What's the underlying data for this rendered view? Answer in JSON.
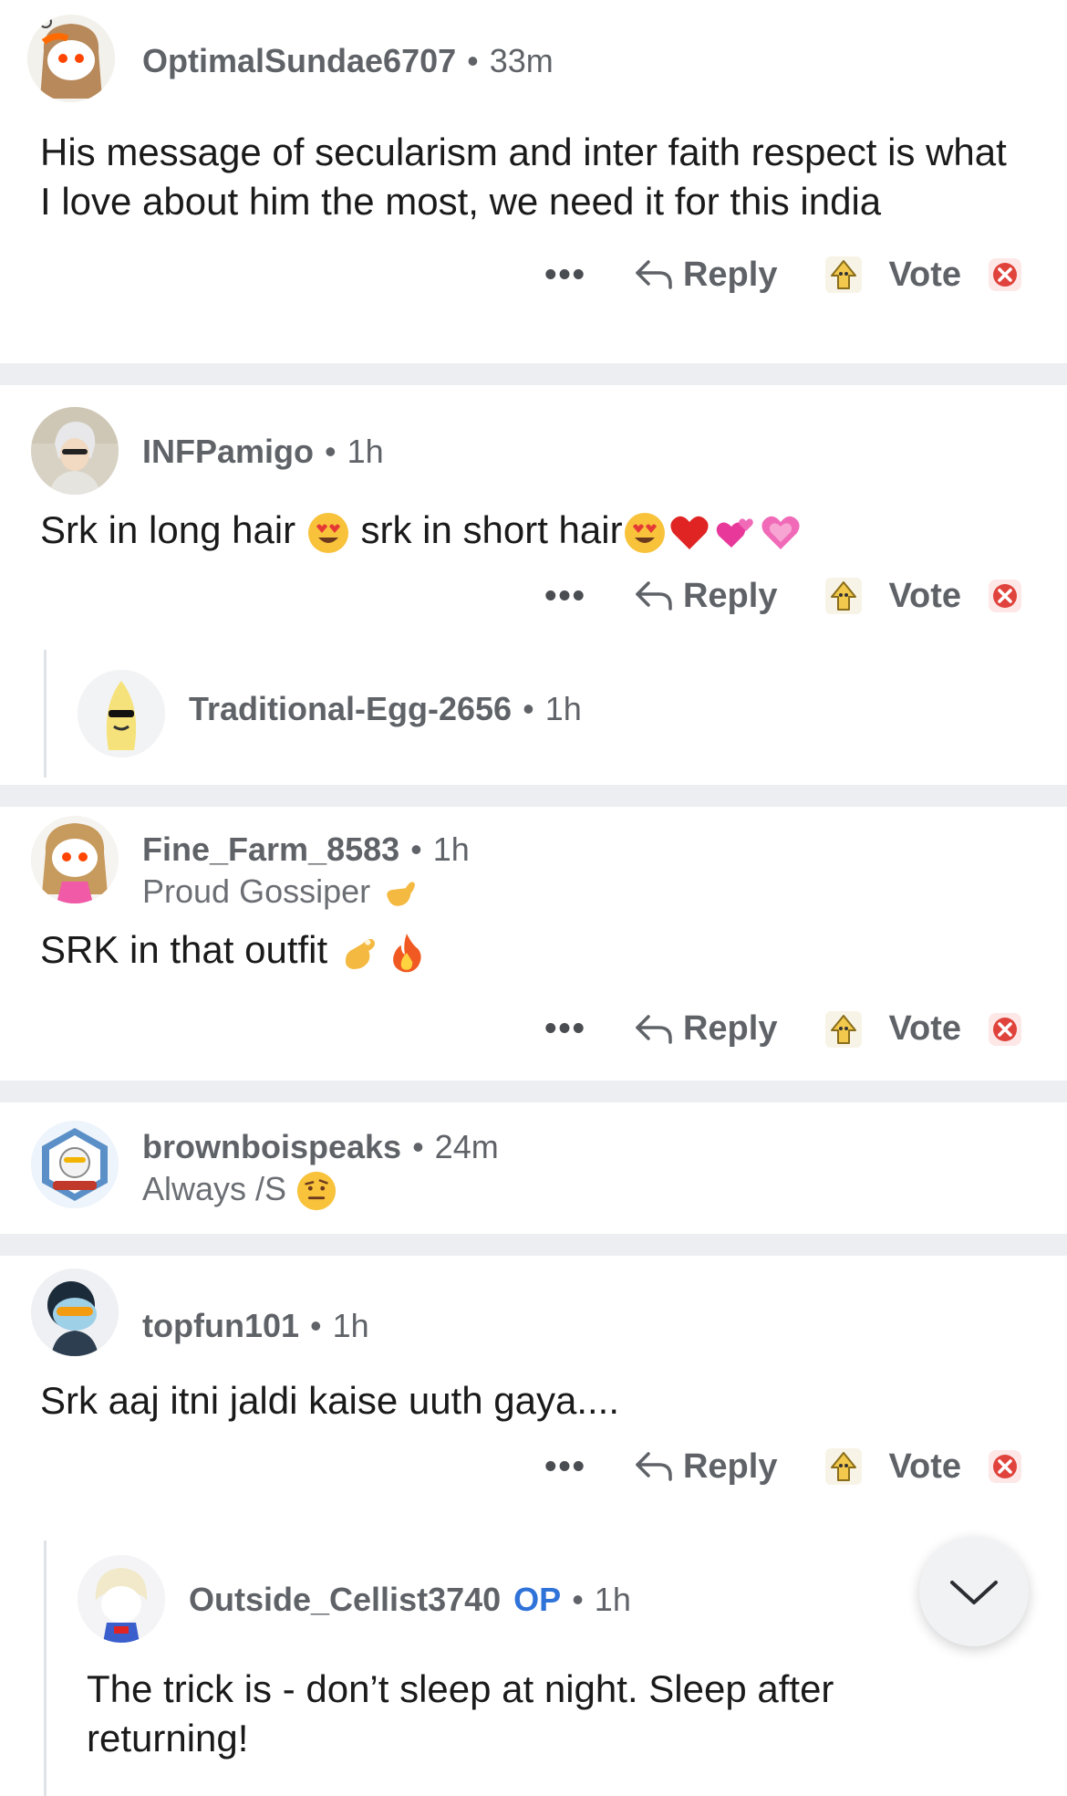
{
  "actions": {
    "more": "•••",
    "reply": "Reply",
    "vote": "Vote"
  },
  "comments": [
    {
      "user": "OptimalSundae6707",
      "time": "33m",
      "text": "His message of secularism and inter faith respect is what I love about him the most, we need it for this india"
    },
    {
      "user": "INFPamigo",
      "time": "1h",
      "text_parts": [
        "Srk in long hair ",
        " srk in short hair"
      ],
      "emojis": [
        "heart-eyes",
        "heart-eyes",
        "red-heart",
        "two-hearts",
        "sparkling-heart"
      ]
    },
    {
      "user": "Traditional-Egg-2656",
      "time": "1h",
      "nested": true
    },
    {
      "user": "Fine_Farm_8583",
      "time": "1h",
      "flair": "Proud Gossiper",
      "text": "SRK in that outfit",
      "emojis": [
        "call-me-hand",
        "pinching-hand",
        "fire"
      ]
    },
    {
      "user": "brownboispeaks",
      "time": "24m",
      "flair": "Always /S",
      "emojis": [
        "raised-eyebrow-face"
      ]
    },
    {
      "user": "topfun101",
      "time": "1h",
      "text": "Srk aaj itni jaldi kaise uuth gaya...."
    },
    {
      "user": "Outside_Cellist3740",
      "op_label": "OP",
      "time": "1h",
      "nested": true,
      "text": "The trick is - don’t sleep at night. Sleep after returning!"
    }
  ],
  "colors": {
    "separator": "#eceef1",
    "op": "#2f73d9",
    "downvote": "#e0433c",
    "upvote": "#f2c94c"
  }
}
